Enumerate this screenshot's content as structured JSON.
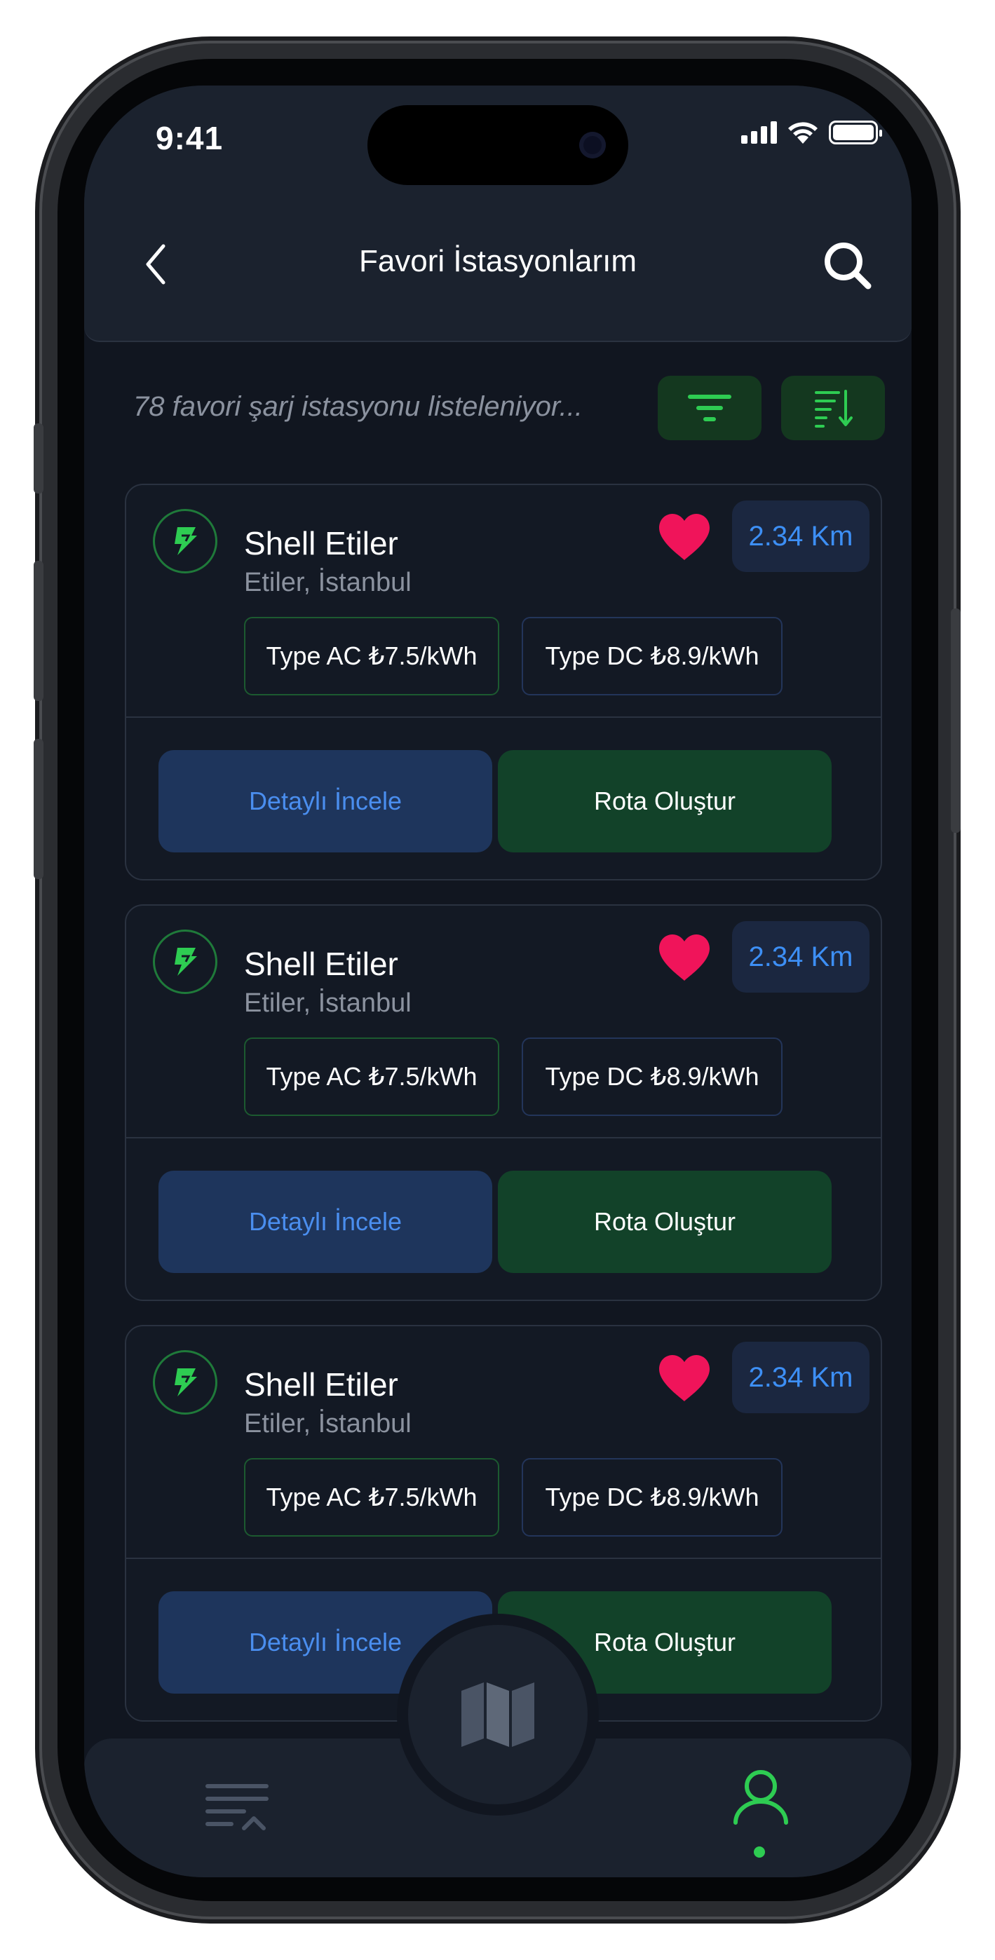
{
  "status_bar": {
    "time": "9:41"
  },
  "header": {
    "title": "Favori İstasyonlarım",
    "back_icon": "chevron-left-icon",
    "search_icon": "search-icon"
  },
  "list": {
    "info": "78 favori şarj istasyonu listeleniyor...",
    "filter_icon": "filter-icon",
    "sort_icon": "sort-icon"
  },
  "stations": [
    {
      "name": "Shell Etiler",
      "location": "Etiler, İstanbul",
      "distance": "2.34 Km",
      "favorite": true,
      "tag_ac": "Type AC ₺7.5/kWh",
      "tag_dc": "Type DC ₺8.9/kWh",
      "detail_label": "Detaylı İncele",
      "route_label": "Rota Oluştur"
    },
    {
      "name": "Shell Etiler",
      "location": "Etiler, İstanbul",
      "distance": "2.34 Km",
      "favorite": true,
      "tag_ac": "Type AC ₺7.5/kWh",
      "tag_dc": "Type DC ₺8.9/kWh",
      "detail_label": "Detaylı İncele",
      "route_label": "Rota Oluştur"
    },
    {
      "name": "Shell Etiler",
      "location": "Etiler, İstanbul",
      "distance": "2.34 Km",
      "favorite": true,
      "tag_ac": "Type AC ₺7.5/kWh",
      "tag_dc": "Type DC ₺8.9/kWh",
      "detail_label": "Detaylı İncele",
      "route_label": "Rota Oluştur"
    }
  ],
  "tabbar": {
    "items": [
      "list-icon",
      "map-icon",
      "profile-icon"
    ],
    "active": "profile-icon"
  },
  "colors": {
    "background": "#111620",
    "header": "#1b222e",
    "accent_green": "#2ecc52",
    "accent_blue": "#3d8ff5",
    "heart": "#f0145a"
  }
}
